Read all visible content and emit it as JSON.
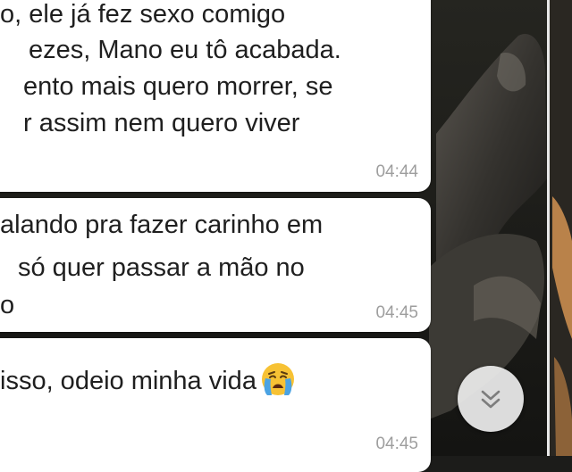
{
  "messages": [
    {
      "lines": [
        "o, ele já fez sexo comigo",
        "ezes, Mano eu tô acabada.",
        "ento mais quero morrer, se",
        "r assim nem quero viver"
      ],
      "time": "04:44"
    },
    {
      "lines": [
        "alando pra fazer carinho em",
        "só quer passar a mão no",
        "o"
      ],
      "time": "04:45"
    },
    {
      "lines": [
        "isso, odeio minha vida"
      ],
      "emoji": "crying-face",
      "time": "04:45"
    }
  ],
  "scroll_button": {
    "icon": "double-chevron-down-icon"
  },
  "colors": {
    "bubble": "#ffffff",
    "time": "#9e9e9e",
    "text": "#1f1f1f",
    "emoji_face": "#f7c234",
    "emoji_tears": "#4ba3e3"
  }
}
